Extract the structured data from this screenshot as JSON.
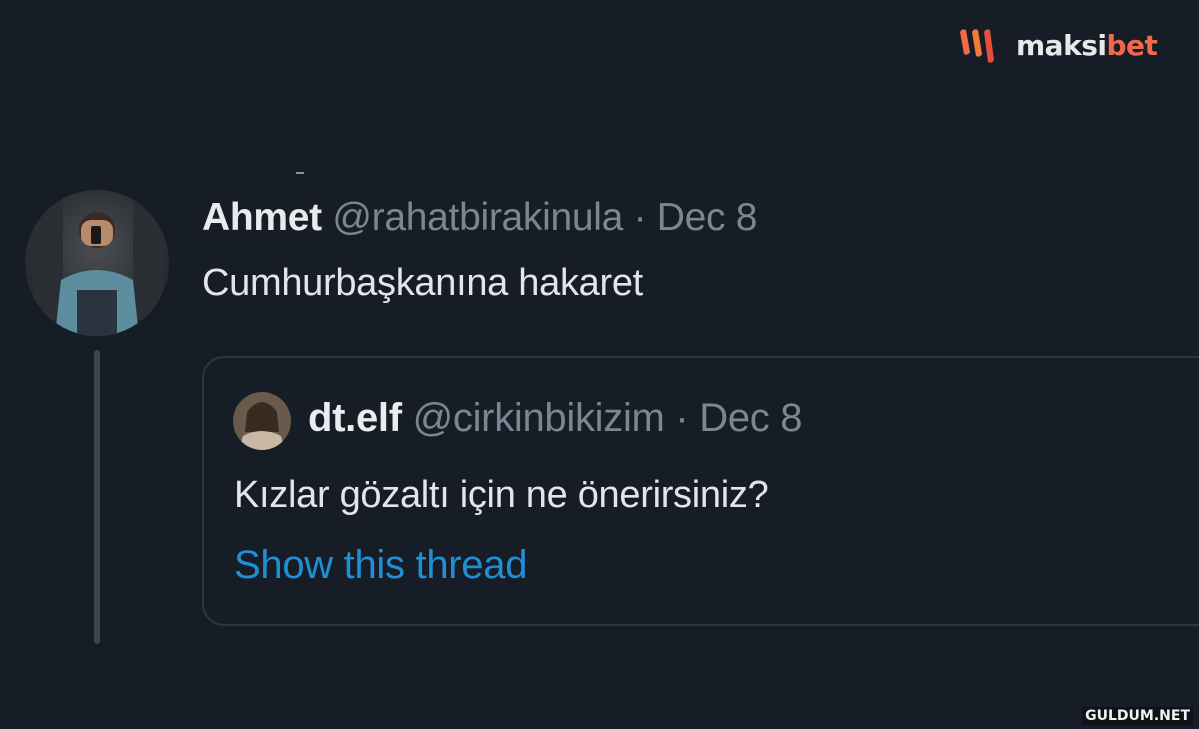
{
  "brand": {
    "logo_icon": "maksibet-logo-icon",
    "name_prefix": "maksi",
    "name_suffix": "bet",
    "accent_color": "#f06a4a"
  },
  "tweet": {
    "name": "Ahmet",
    "handle": "@rahatbirakinula",
    "separator": "·",
    "date": "Dec 8",
    "text": "Cumhurbaşkanına hakaret",
    "avatar_icon": "user-avatar-icon"
  },
  "quoted_tweet": {
    "name": "dt.elf",
    "handle": "@cirkinbikizim",
    "separator": "·",
    "date": "Dec 8",
    "text": "Kızlar gözaltı için ne önerirsiniz?",
    "link_label": "Show this thread",
    "link_color": "#1f8fd6",
    "avatar_icon": "user-avatar-icon"
  },
  "watermark": {
    "text": "GULDUM.NET"
  }
}
